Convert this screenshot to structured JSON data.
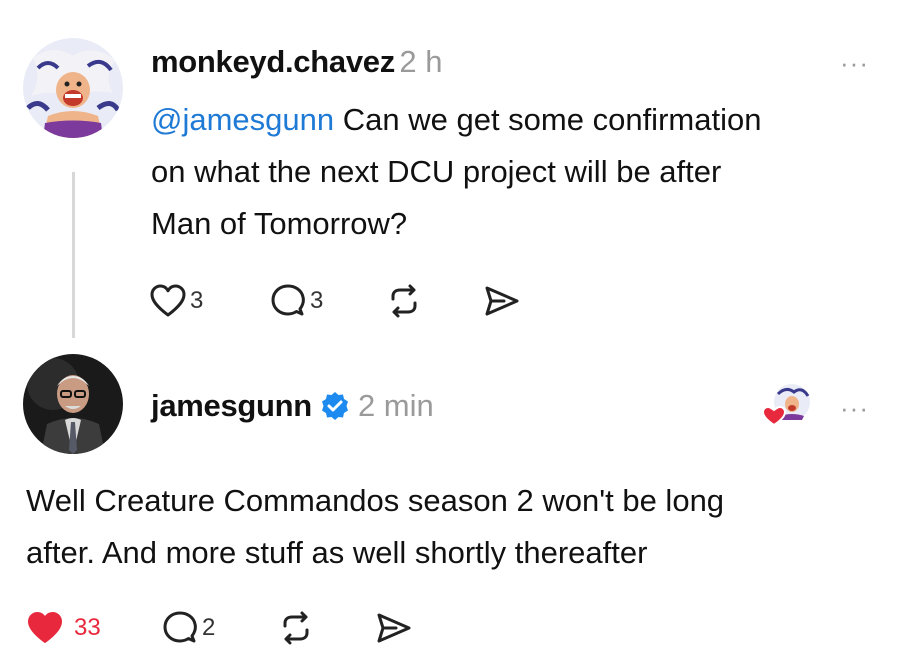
{
  "post": {
    "username": "monkeyd.chavez",
    "time": "2 h",
    "mention": "@jamesgunn",
    "text_line1_rest": " Can we get some confirmation",
    "text_line2": "on what the next DCU project will be after",
    "text_line3": "Man of Tomorrow?",
    "likes": "3",
    "replies": "3",
    "more": "···"
  },
  "reply": {
    "username": "jamesgunn",
    "time": "2 min",
    "verified": true,
    "text_line1": "Well Creature Commandos season 2 won't be long",
    "text_line2": "after. And more stuff as well shortly thereafter",
    "likes": "33",
    "replies": "2",
    "liked": true,
    "more": "···"
  },
  "colors": {
    "mention": "#1f7ad6",
    "like_red": "#e8283c",
    "verified_blue": "#1d8af0",
    "muted": "#9a9a9a"
  },
  "icons": [
    "heart-icon",
    "comment-icon",
    "repost-icon",
    "share-icon",
    "verified-badge-icon",
    "more-icon"
  ]
}
